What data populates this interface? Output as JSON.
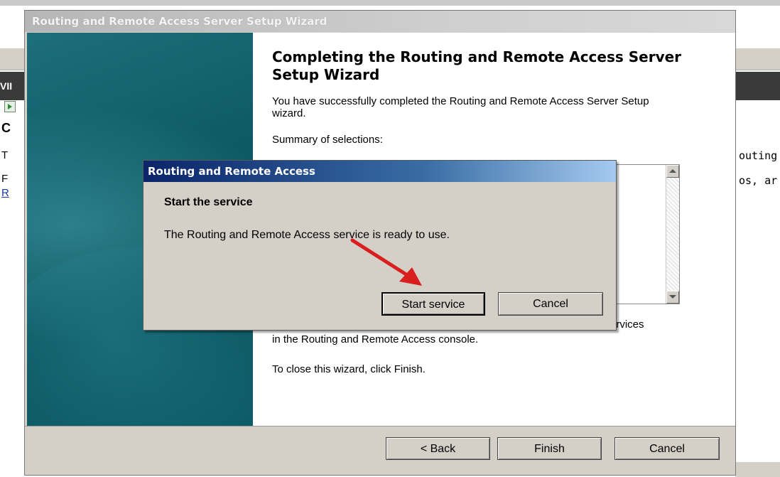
{
  "background": {
    "dark_bar_text": "VII",
    "left_fragments": [
      "C",
      "T",
      "F",
      "R"
    ],
    "right_fragments": [
      "outing",
      "os, ar"
    ]
  },
  "wizard": {
    "title": "Routing and Remote Access Server Setup Wizard",
    "heading": "Completing the Routing and Remote Access Server Setup Wizard",
    "success_text": "You have successfully completed the Routing and Remote Access Server Setup wizard.",
    "summary_label": "Summary of selections:",
    "manage_text_suffix": "ervices",
    "manage_text_line2": "in the Routing and  Remote Access console.",
    "close_text": "To close this wizard, click Finish.",
    "buttons": {
      "back": "< Back",
      "finish": "Finish",
      "cancel": "Cancel"
    }
  },
  "dialog": {
    "title": "Routing and Remote Access",
    "heading": "Start the service",
    "message": "The Routing and Remote Access service is ready to use.",
    "buttons": {
      "start": "Start service",
      "cancel": "Cancel"
    }
  },
  "annotation": {
    "arrow_color": "#d81e1e"
  },
  "colors": {
    "dialog_title_start": "#0a246a",
    "dialog_title_end": "#a6caf0",
    "wizard_panel": "#0f5c66"
  }
}
